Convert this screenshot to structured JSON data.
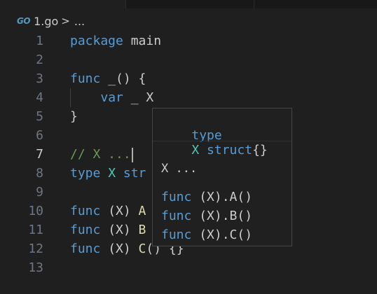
{
  "breadcrumb": {
    "file": "1.go",
    "icon": "go-file-icon",
    "separator": ">",
    "more": "..."
  },
  "editor": {
    "active_line": 7,
    "lines": [
      {
        "num": "1",
        "tokens": [
          {
            "t": "package",
            "c": "kw"
          },
          {
            "t": " ",
            "c": "plain"
          },
          {
            "t": "main",
            "c": "plain"
          }
        ]
      },
      {
        "num": "2",
        "tokens": []
      },
      {
        "num": "3",
        "tokens": [
          {
            "t": "func",
            "c": "kw"
          },
          {
            "t": " _() {",
            "c": "plain"
          }
        ]
      },
      {
        "num": "4",
        "tokens": [
          {
            "t": "    ",
            "c": "plain"
          },
          {
            "t": "var",
            "c": "kw"
          },
          {
            "t": " _ X",
            "c": "plain"
          }
        ]
      },
      {
        "num": "5",
        "tokens": [
          {
            "t": "}",
            "c": "plain"
          }
        ]
      },
      {
        "num": "6",
        "tokens": []
      },
      {
        "num": "7",
        "tokens": [
          {
            "t": "// X ...",
            "c": "comment"
          }
        ]
      },
      {
        "num": "8",
        "tokens": [
          {
            "t": "type",
            "c": "kw"
          },
          {
            "t": " ",
            "c": "plain"
          },
          {
            "t": "X",
            "c": "type"
          },
          {
            "t": " str",
            "c": "kw"
          }
        ]
      },
      {
        "num": "9",
        "tokens": []
      },
      {
        "num": "10",
        "tokens": [
          {
            "t": "func",
            "c": "kw"
          },
          {
            "t": " (X) ",
            "c": "plain"
          },
          {
            "t": "A",
            "c": "fn"
          }
        ]
      },
      {
        "num": "11",
        "tokens": [
          {
            "t": "func",
            "c": "kw"
          },
          {
            "t": " (X) ",
            "c": "plain"
          },
          {
            "t": "B",
            "c": "fn"
          }
        ]
      },
      {
        "num": "12",
        "tokens": [
          {
            "t": "func",
            "c": "kw"
          },
          {
            "t": " (X) ",
            "c": "plain"
          },
          {
            "t": "C",
            "c": "fn"
          },
          {
            "t": "() {}",
            "c": "plain"
          }
        ]
      },
      {
        "num": "13",
        "tokens": []
      }
    ]
  },
  "hover": {
    "signature": {
      "kw": "type",
      "name": "X",
      "rest": " struct",
      "braces": "{}"
    },
    "doc": "X ...",
    "methods": [
      {
        "kw": "func",
        "text": " (X).A()"
      },
      {
        "kw": "func",
        "text": " (X).B()"
      },
      {
        "kw": "func",
        "text": " (X).C()"
      }
    ]
  },
  "colors": {
    "background": "#1f1f1f",
    "keyword": "#569cd6",
    "type": "#4ec9b0",
    "function": "#dcdcaa",
    "comment": "#6a9955",
    "text": "#cccccc",
    "line_number": "#6e7681"
  }
}
